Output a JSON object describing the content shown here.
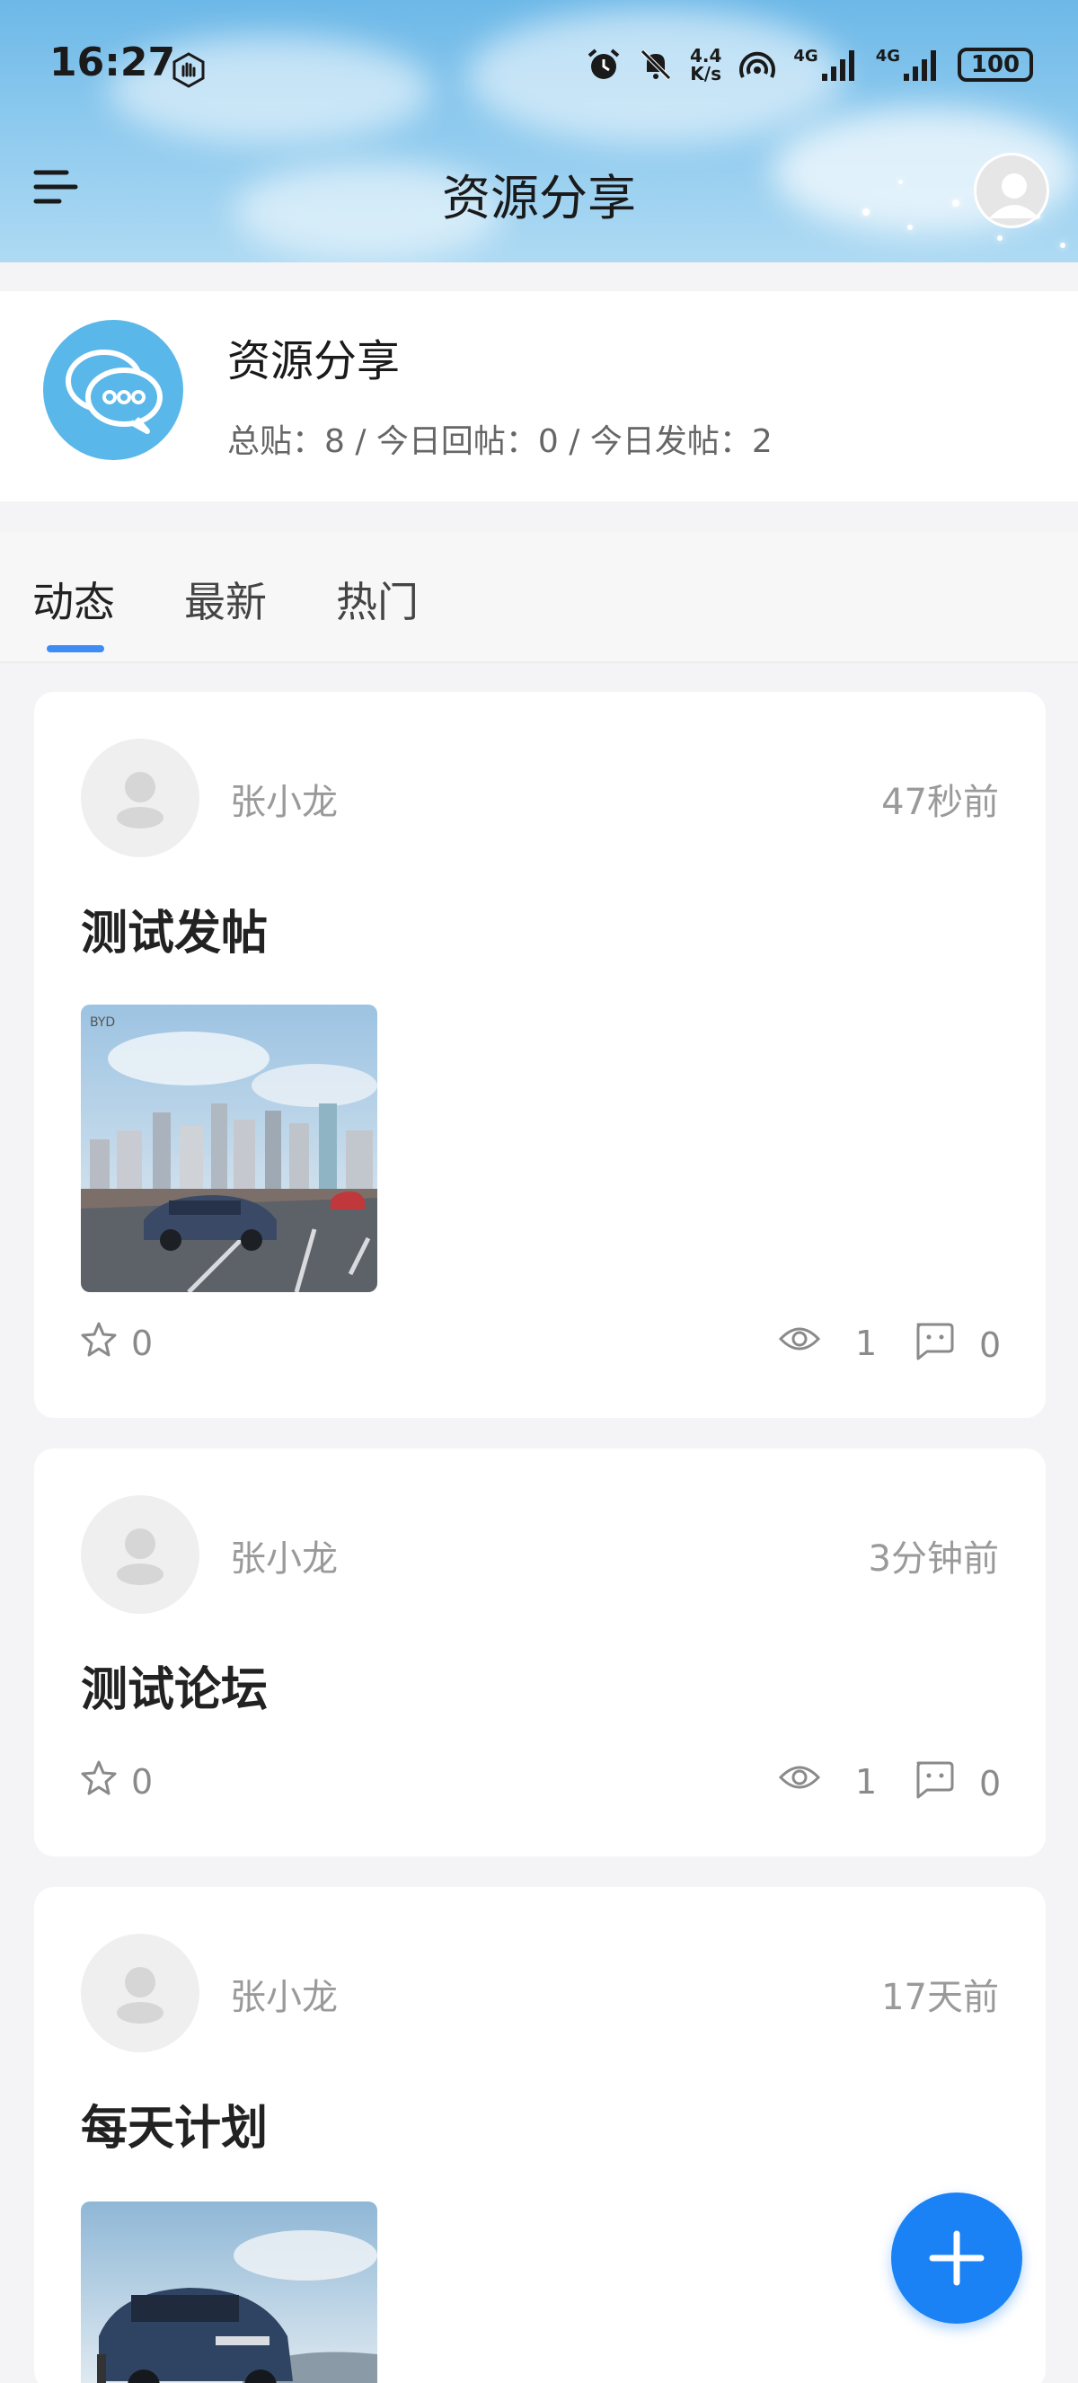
{
  "status_bar": {
    "time": "16:27",
    "net_speed_top": "4.4",
    "net_speed_bottom": "K/s",
    "signal1_label": "4G",
    "signal2_label": "4G",
    "battery": "100"
  },
  "header": {
    "title": "资源分享"
  },
  "forum": {
    "name": "资源分享",
    "stats": "总贴：8 / 今日回帖：0 / 今日发帖：2"
  },
  "tabs": [
    {
      "label": "动态",
      "active": true
    },
    {
      "label": "最新",
      "active": false
    },
    {
      "label": "热门",
      "active": false
    }
  ],
  "posts": [
    {
      "author": "张小龙",
      "time": "47秒前",
      "title": "测试发帖",
      "has_image": true,
      "stars": "0",
      "views": "1",
      "comments": "0",
      "image_logo": "BYD"
    },
    {
      "author": "张小龙",
      "time": "3分钟前",
      "title": "测试论坛",
      "has_image": false,
      "stars": "0",
      "views": "1",
      "comments": "0"
    },
    {
      "author": "张小龙",
      "time": "17天前",
      "title": "每天计划",
      "has_image": true
    }
  ],
  "colors": {
    "accent": "#1a82f5",
    "tab_indicator": "#3f8cf5",
    "forum_logo": "#5ab7e9"
  },
  "icons": [
    "menu-icon",
    "user-avatar-icon",
    "chat-bubble-icon",
    "star-icon",
    "eye-icon",
    "comment-icon",
    "plus-icon",
    "alarm-icon",
    "mute-icon",
    "hotspot-icon",
    "signal-icon",
    "battery-icon"
  ]
}
